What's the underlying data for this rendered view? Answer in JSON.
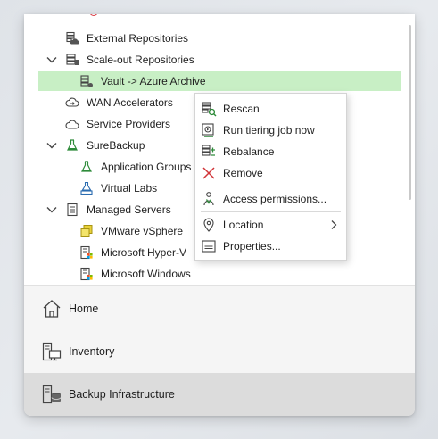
{
  "tree": {
    "items": [
      {
        "label": "External Repositories",
        "icon": "cloud-storage-icon"
      },
      {
        "label": "Scale-out Repositories",
        "icon": "scale-out-repository-icon",
        "expanded": true
      },
      {
        "label": "Vault -> Azure Archive",
        "icon": "repository-icon",
        "selected": true
      },
      {
        "label": "WAN Accelerators",
        "icon": "wan-accelerator-icon"
      },
      {
        "label": "Service Providers",
        "icon": "cloud-icon"
      },
      {
        "label": "SureBackup",
        "icon": "flask-icon",
        "expanded": true
      },
      {
        "label": "Application Groups",
        "icon": "application-group-icon"
      },
      {
        "label": "Virtual Labs",
        "icon": "virtual-lab-icon"
      },
      {
        "label": "Managed Servers",
        "icon": "managed-servers-icon",
        "expanded": true
      },
      {
        "label": "VMware vSphere",
        "icon": "vmware-icon"
      },
      {
        "label": "Microsoft Hyper-V",
        "icon": "hyper-v-icon"
      },
      {
        "label": "Microsoft Windows",
        "icon": "windows-icon"
      }
    ]
  },
  "context_menu": {
    "items": [
      {
        "label": "Rescan",
        "icon": "rescan-icon"
      },
      {
        "label": "Run tiering job now",
        "icon": "tiering-job-icon"
      },
      {
        "label": "Rebalance",
        "icon": "rebalance-icon"
      },
      {
        "label": "Remove",
        "icon": "remove-x-icon"
      },
      {
        "label": "Access permissions...",
        "icon": "access-permissions-icon"
      },
      {
        "label": "Location",
        "icon": "location-pin-icon",
        "submenu": true
      },
      {
        "label": "Properties...",
        "icon": "properties-icon"
      }
    ]
  },
  "nav": {
    "items": [
      {
        "label": "Home",
        "icon": "home-icon"
      },
      {
        "label": "Inventory",
        "icon": "inventory-icon"
      },
      {
        "label": "Backup Infrastructure",
        "icon": "backup-infrastructure-icon",
        "active": true
      }
    ]
  },
  "colors": {
    "selection": "#c8efc5",
    "remove_red": "#d13438",
    "flask_green": "#2e8b3a",
    "nav_active": "#dcdcdc"
  }
}
